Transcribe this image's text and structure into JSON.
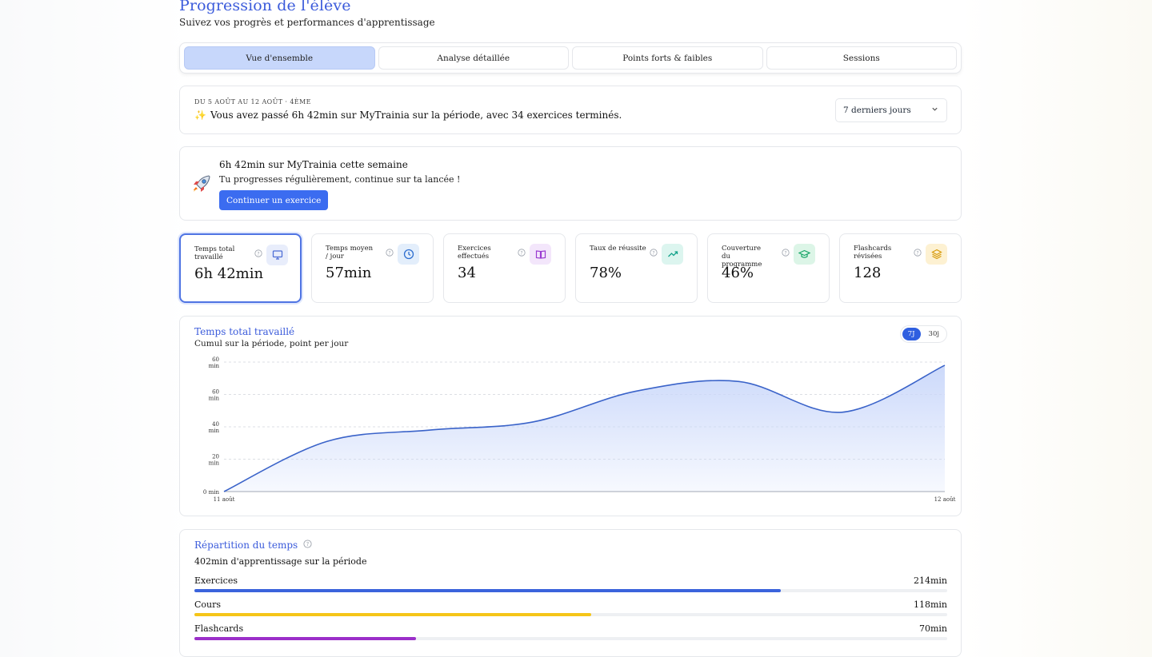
{
  "header": {
    "title": "Progression de l'élève",
    "subtitle": "Suivez vos progrès et performances d'apprentissage"
  },
  "tabs": [
    {
      "label": "Vue d'ensemble",
      "active": true
    },
    {
      "label": "Analyse détaillée",
      "active": false
    },
    {
      "label": "Points forts & faibles",
      "active": false
    },
    {
      "label": "Sessions",
      "active": false
    }
  ],
  "period": {
    "label": "du 5 août au 12 août · 4ème",
    "message": "Vous avez passé 6h 42min sur MyTrainia sur la période, avec 34 exercices terminés.",
    "select_value": "7 derniers jours"
  },
  "promo": {
    "title": "6h 42min sur MyTrainia cette semaine",
    "text": "Tu progresses régulièrement, continue sur ta lancée !",
    "button": "Continuer un exercice"
  },
  "stats": [
    {
      "label": "Temps total travaillé",
      "value": "6h 42min",
      "icon": "monitor-icon",
      "color": "#4f6fd6",
      "bg": "#e8edfb"
    },
    {
      "label": "Temps moyen / jour",
      "value": "57min",
      "icon": "clock-icon",
      "color": "#2f6fd0",
      "bg": "#e3eefb"
    },
    {
      "label": "Exercices effectués",
      "value": "34",
      "icon": "book-icon",
      "color": "#9a3bd1",
      "bg": "#f3e6fb"
    },
    {
      "label": "Taux de réussite",
      "value": "78%",
      "icon": "trending-up-icon",
      "color": "#14a38b",
      "bg": "#dcf5ef"
    },
    {
      "label": "Couverture du programme",
      "value": "46%",
      "icon": "graduation-cap-icon",
      "color": "#17a567",
      "bg": "#dcf5e7"
    },
    {
      "label": "Flashcards révisées",
      "value": "128",
      "icon": "layers-icon",
      "color": "#d79a0a",
      "bg": "#fdf1d2"
    }
  ],
  "chart": {
    "title": "Temps total travaillé",
    "subtitle": "Cumul sur la période, point per jour",
    "toggle": [
      "7J",
      "30j"
    ],
    "active_toggle": "7J",
    "line_color": "#3a63c9",
    "fill_color": "#c9d7fa"
  },
  "chart_data": {
    "type": "area",
    "x": [
      "11 août",
      "",
      "",
      "",
      "",
      "",
      "",
      "12 août"
    ],
    "y_tick_labels": [
      "0 min",
      "20 min",
      "40 min",
      "60 min",
      "60 min"
    ],
    "series": [
      {
        "values": [
          0,
          31,
          38,
          43,
          62,
          68,
          49,
          78
        ]
      }
    ],
    "ylim": [
      0,
      80
    ],
    "grid": true,
    "xlabel": "",
    "ylabel": ""
  },
  "repartition": {
    "title": "Répartition du temps",
    "total": "402min  d'apprentissage sur la période",
    "items": [
      {
        "label": "Exercices",
        "value": "214min",
        "fraction": 0.779,
        "color": "#3b63dc"
      },
      {
        "label": "Cours",
        "value": "118min",
        "fraction": 0.527,
        "color": "#f5c518"
      },
      {
        "label": "Flashcards",
        "value": "70min",
        "fraction": 0.294,
        "color": "#9b2fc9"
      }
    ]
  }
}
